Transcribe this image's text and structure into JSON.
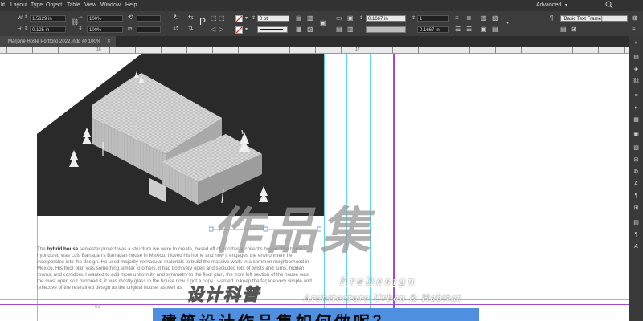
{
  "menu": {
    "items": [
      "lit",
      "Layout",
      "Type",
      "Object",
      "Table",
      "View",
      "Window",
      "Help"
    ],
    "workspace": "Advanced"
  },
  "control": {
    "w_label": "W:",
    "w_value": "1.5129 in",
    "h_label": "H:",
    "h_value": "0.125 in",
    "scale_x": "100%",
    "scale_y": "100%",
    "stroke_weight": "0 pt",
    "scale_x2": "100%",
    "inset_1": "0.1667 in",
    "columns": "1",
    "inset_2": "0.1667 in",
    "frame_style": "[Basic Text Frame]+"
  },
  "document_tab": {
    "title": "Marjorie Hosle Portfolio 2022.indd @ 100%"
  },
  "ruler": {
    "labels": [
      "16",
      "17"
    ]
  },
  "page": {
    "body_bold": "hybrid house",
    "body_pre": "The ",
    "body_text": " semester project was a structure we were to create, based off of another architect's house. The home I hybridized was Luis Barragan's Barragan house in Mexico. I loved his home and how it engages the environment he incorporates into the design. He used majority vernacular materials to build the massive walls in a common neighborhood in Mexico. His floor plan was something similar to others, it had both very open and secluded lots of twists and turns, hidden rooms, and corridors. I wanted to add more uniformity and symmetry to the floor plan, the front left section of the house was the most open so I mirrored it, it was mostly glass in the house now. I got a copy I wanted to keep the façade very simple and reflective of the restrained design as the original house, as well as",
    "page_number": "01"
  },
  "watermark": {
    "big": "作品集",
    "brand": "FreDesign",
    "cn_small": "设计科普",
    "tagline": "Architecture Urban & Habitat",
    "banner": "建筑设计作品集如何做呢？"
  },
  "colors": {
    "guide_cyan": "#5fd6e6",
    "guide_magenta": "#a24bd3",
    "banner_blue": "#4e8fe0"
  },
  "icons": [
    "search-icon",
    "collapse-icon",
    "pages-panel-icon",
    "layers-panel-icon",
    "links-panel-icon",
    "stroke-panel-icon",
    "color-panel-icon",
    "swatches-panel-icon",
    "cc-libraries-icon",
    "effects-panel-icon",
    "text-wrap-icon",
    "align-panel-icon"
  ]
}
